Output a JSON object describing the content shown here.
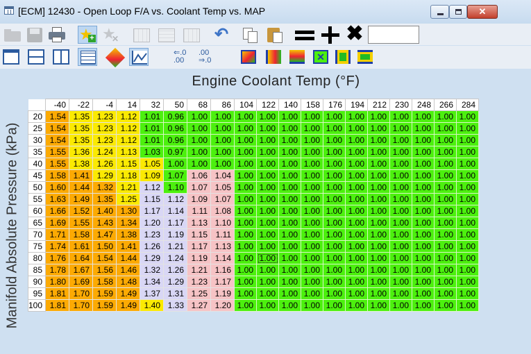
{
  "window": {
    "title": "[ECM] 12430 - Open Loop F/A vs. Coolant Temp vs. MAP",
    "minimize_label": "",
    "maximize_label": "",
    "close_label": "✕"
  },
  "toolbar": {
    "value_input": "",
    "icons_row1": [
      "open-icon",
      "save-icon",
      "print-icon",
      "favorite-add-icon",
      "favorite-remove-icon",
      "table-insert-icon",
      "table-grid-icon",
      "table-edit-icon",
      "undo-icon",
      "copy-icon",
      "paste-icon",
      "equals-icon",
      "plus-icon",
      "multiply-icon"
    ],
    "icons_row2": [
      "single-view-icon",
      "split-horizontal-icon",
      "split-vertical-icon",
      "table-view-icon",
      "shape-3d-icon",
      "graph-icon",
      "decimal-decrease-icon",
      "decimal-increase-icon",
      "interpolate-3d-icon",
      "interpolate-left-icon",
      "interpolate-down-icon",
      "interpolate-center-icon",
      "interpolate-cols-icon",
      "interpolate-rows-icon"
    ],
    "decimal_decrease": "←.0 .00",
    "decimal_increase": ".00 ⇒.0"
  },
  "axes": {
    "x_title": "Engine Coolant Temp (°F)",
    "y_title": "Manifold Absolute Pressure (kPa)"
  },
  "table": {
    "columns": [
      "-40",
      "-22",
      "-4",
      "14",
      "32",
      "50",
      "68",
      "86",
      "104",
      "122",
      "140",
      "158",
      "176",
      "194",
      "212",
      "230",
      "248",
      "266",
      "284"
    ],
    "rows": [
      {
        "label": "20",
        "values": [
          "1.54",
          "1.35",
          "1.23",
          "1.12",
          "1.01",
          "0.96",
          "1.00",
          "1.00",
          "1.00",
          "1.00",
          "1.00",
          "1.00",
          "1.00",
          "1.00",
          "1.00",
          "1.00",
          "1.00",
          "1.00",
          "1.00"
        ]
      },
      {
        "label": "25",
        "values": [
          "1.54",
          "1.35",
          "1.23",
          "1.12",
          "1.01",
          "0.96",
          "1.00",
          "1.00",
          "1.00",
          "1.00",
          "1.00",
          "1.00",
          "1.00",
          "1.00",
          "1.00",
          "1.00",
          "1.00",
          "1.00",
          "1.00"
        ]
      },
      {
        "label": "30",
        "values": [
          "1.54",
          "1.35",
          "1.23",
          "1.12",
          "1.01",
          "0.96",
          "1.00",
          "1.00",
          "1.00",
          "1.00",
          "1.00",
          "1.00",
          "1.00",
          "1.00",
          "1.00",
          "1.00",
          "1.00",
          "1.00",
          "1.00"
        ]
      },
      {
        "label": "35",
        "values": [
          "1.55",
          "1.36",
          "1.24",
          "1.13",
          "1.03",
          "0.97",
          "1.00",
          "1.00",
          "1.00",
          "1.00",
          "1.00",
          "1.00",
          "1.00",
          "1.00",
          "1.00",
          "1.00",
          "1.00",
          "1.00",
          "1.00"
        ]
      },
      {
        "label": "40",
        "values": [
          "1.55",
          "1.38",
          "1.26",
          "1.15",
          "1.05",
          "1.00",
          "1.00",
          "1.00",
          "1.00",
          "1.00",
          "1.00",
          "1.00",
          "1.00",
          "1.00",
          "1.00",
          "1.00",
          "1.00",
          "1.00",
          "1.00"
        ]
      },
      {
        "label": "45",
        "values": [
          "1.58",
          "1.41",
          "1.29",
          "1.18",
          "1.09",
          "1.07",
          "1.06",
          "1.04",
          "1.00",
          "1.00",
          "1.00",
          "1.00",
          "1.00",
          "1.00",
          "1.00",
          "1.00",
          "1.00",
          "1.00",
          "1.00"
        ]
      },
      {
        "label": "50",
        "values": [
          "1.60",
          "1.44",
          "1.32",
          "1.21",
          "1.12",
          "1.10",
          "1.07",
          "1.05",
          "1.00",
          "1.00",
          "1.00",
          "1.00",
          "1.00",
          "1.00",
          "1.00",
          "1.00",
          "1.00",
          "1.00",
          "1.00"
        ]
      },
      {
        "label": "55",
        "values": [
          "1.63",
          "1.49",
          "1.35",
          "1.25",
          "1.15",
          "1.12",
          "1.09",
          "1.07",
          "1.00",
          "1.00",
          "1.00",
          "1.00",
          "1.00",
          "1.00",
          "1.00",
          "1.00",
          "1.00",
          "1.00",
          "1.00"
        ]
      },
      {
        "label": "60",
        "values": [
          "1.66",
          "1.52",
          "1.40",
          "1.30",
          "1.17",
          "1.14",
          "1.11",
          "1.08",
          "1.00",
          "1.00",
          "1.00",
          "1.00",
          "1.00",
          "1.00",
          "1.00",
          "1.00",
          "1.00",
          "1.00",
          "1.00"
        ]
      },
      {
        "label": "65",
        "values": [
          "1.69",
          "1.55",
          "1.43",
          "1.34",
          "1.20",
          "1.17",
          "1.13",
          "1.10",
          "1.00",
          "1.00",
          "1.00",
          "1.00",
          "1.00",
          "1.00",
          "1.00",
          "1.00",
          "1.00",
          "1.00",
          "1.00"
        ]
      },
      {
        "label": "70",
        "values": [
          "1.71",
          "1.58",
          "1.47",
          "1.38",
          "1.23",
          "1.19",
          "1.15",
          "1.11",
          "1.00",
          "1.00",
          "1.00",
          "1.00",
          "1.00",
          "1.00",
          "1.00",
          "1.00",
          "1.00",
          "1.00",
          "1.00"
        ]
      },
      {
        "label": "75",
        "values": [
          "1.74",
          "1.61",
          "1.50",
          "1.41",
          "1.26",
          "1.21",
          "1.17",
          "1.13",
          "1.00",
          "1.00",
          "1.00",
          "1.00",
          "1.00",
          "1.00",
          "1.00",
          "1.00",
          "1.00",
          "1.00",
          "1.00"
        ]
      },
      {
        "label": "80",
        "values": [
          "1.76",
          "1.64",
          "1.54",
          "1.44",
          "1.29",
          "1.24",
          "1.19",
          "1.14",
          "1.00",
          "1.00",
          "1.00",
          "1.00",
          "1.00",
          "1.00",
          "1.00",
          "1.00",
          "1.00",
          "1.00",
          "1.00"
        ]
      },
      {
        "label": "85",
        "values": [
          "1.78",
          "1.67",
          "1.56",
          "1.46",
          "1.32",
          "1.26",
          "1.21",
          "1.16",
          "1.00",
          "1.00",
          "1.00",
          "1.00",
          "1.00",
          "1.00",
          "1.00",
          "1.00",
          "1.00",
          "1.00",
          "1.00"
        ]
      },
      {
        "label": "90",
        "values": [
          "1.80",
          "1.69",
          "1.58",
          "1.48",
          "1.34",
          "1.29",
          "1.23",
          "1.17",
          "1.00",
          "1.00",
          "1.00",
          "1.00",
          "1.00",
          "1.00",
          "1.00",
          "1.00",
          "1.00",
          "1.00",
          "1.00"
        ]
      },
      {
        "label": "95",
        "values": [
          "1.81",
          "1.70",
          "1.59",
          "1.49",
          "1.37",
          "1.31",
          "1.25",
          "1.19",
          "1.00",
          "1.00",
          "1.00",
          "1.00",
          "1.00",
          "1.00",
          "1.00",
          "1.00",
          "1.00",
          "1.00",
          "1.00"
        ]
      },
      {
        "label": "100",
        "values": [
          "1.81",
          "1.70",
          "1.59",
          "1.49",
          "1.40",
          "1.33",
          "1.27",
          "1.20",
          "1.00",
          "1.00",
          "1.00",
          "1.00",
          "1.00",
          "1.00",
          "1.00",
          "1.00",
          "1.00",
          "1.00",
          "1.00"
        ]
      }
    ],
    "selected_cell": {
      "row_label": "80",
      "column_label": "122"
    }
  },
  "colors": {
    "orange": "#fcaa03",
    "yellow": "#fbea02",
    "green": "#4cf00e",
    "lavender": "#d9d7f5",
    "pink": "#f6c3c5"
  }
}
